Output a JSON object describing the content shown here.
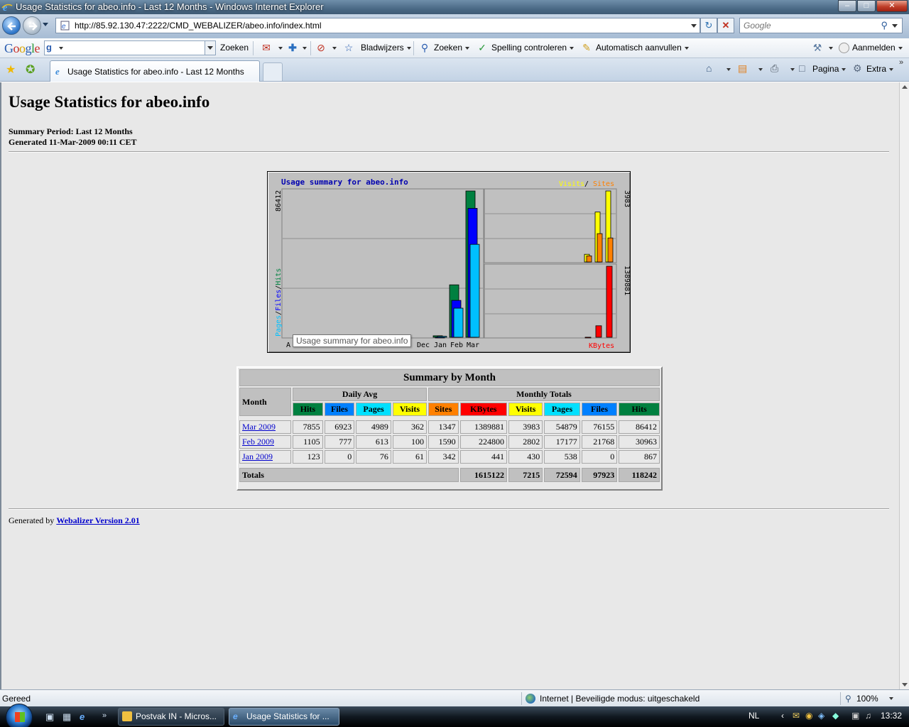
{
  "window": {
    "title": "Usage Statistics for abeo.info - Last 12 Months - Windows Internet Explorer"
  },
  "address_bar": {
    "url": "http://85.92.130.47:2222/CMD_WEBALIZER/abeo.info/index.html",
    "search_placeholder": "Google"
  },
  "google_toolbar": {
    "search_label": "Zoeken",
    "bookmarks_label": "Bladwijzers",
    "search2_label": "Zoeken",
    "spellcheck_label": "Spelling controleren",
    "autofill_label": "Automatisch aanvullen",
    "signin_label": "Aanmelden"
  },
  "tabs": {
    "active_tab_label": "Usage Statistics for abeo.info - Last 12 Months"
  },
  "command_bar": {
    "page_label": "Pagina",
    "extra_label": "Extra"
  },
  "page": {
    "title": "Usage Statistics for abeo.info",
    "summary_period": "Summary Period: Last 12 Months",
    "generated": "Generated 11-Mar-2009 00:11 CET"
  },
  "graph": {
    "title": "Usage summary for abeo.info",
    "legend_left": [
      "Pages",
      "Files",
      "Hits"
    ],
    "legend_visits": "Visits",
    "legend_sites": "Sites",
    "legend_kbytes": "KBytes",
    "max_hits_label": "86412",
    "max_visits_label": "3983",
    "max_kbytes_label": "1389881",
    "month_labels": [
      "Dec",
      "Jan",
      "Feb",
      "Mar"
    ],
    "partial_left_label": "A",
    "colors": {
      "hits": "#008040",
      "files": "#0000ff",
      "pages": "#00c0ff",
      "visits": "#ffff00",
      "sites": "#ff8000",
      "kbytes": "#ff0000"
    },
    "tooltip": "Usage summary for abeo.info"
  },
  "chart_data": {
    "type": "bar",
    "title": "Usage summary for abeo.info",
    "categories": [
      "Jan 2009",
      "Feb 2009",
      "Mar 2009"
    ],
    "series": [
      {
        "name": "Hits",
        "values": [
          867,
          30963,
          86412
        ]
      },
      {
        "name": "Files",
        "values": [
          0,
          21768,
          76155
        ]
      },
      {
        "name": "Pages",
        "values": [
          538,
          17177,
          54879
        ]
      },
      {
        "name": "Visits",
        "values": [
          430,
          2802,
          3983
        ]
      },
      {
        "name": "Sites",
        "values": [
          342,
          1590,
          1347
        ]
      },
      {
        "name": "KBytes",
        "values": [
          441,
          224800,
          1389881
        ]
      }
    ]
  },
  "table": {
    "caption": "Summary by Month",
    "month_header": "Month",
    "daily_avg_header": "Daily Avg",
    "monthly_totals_header": "Monthly Totals",
    "daily_cols": [
      "Hits",
      "Files",
      "Pages",
      "Visits"
    ],
    "monthly_cols": [
      "Sites",
      "KBytes",
      "Visits",
      "Pages",
      "Files",
      "Hits"
    ],
    "col_colors": {
      "Hits": "#008040",
      "Files": "#0080ff",
      "Pages": "#00e0ff",
      "Visits": "#ffff00",
      "Sites": "#ff8000",
      "KBytes": "#ff0000"
    },
    "rows": [
      {
        "month": "Mar 2009",
        "cells": [
          "7855",
          "6923",
          "4989",
          "362",
          "1347",
          "1389881",
          "3983",
          "54879",
          "76155",
          "86412"
        ]
      },
      {
        "month": "Feb 2009",
        "cells": [
          "1105",
          "777",
          "613",
          "100",
          "1590",
          "224800",
          "2802",
          "17177",
          "21768",
          "30963"
        ]
      },
      {
        "month": "Jan 2009",
        "cells": [
          "123",
          "0",
          "76",
          "61",
          "342",
          "441",
          "430",
          "538",
          "0",
          "867"
        ]
      }
    ],
    "totals_label": "Totals",
    "totals": [
      "1615122",
      "7215",
      "72594",
      "97923",
      "118242"
    ]
  },
  "footer": {
    "prefix": "Generated by ",
    "link": "Webalizer Version 2.01"
  },
  "status_bar": {
    "status": "Gereed",
    "zone": "Internet | Beveiligde modus: uitgeschakeld",
    "zoom": "100%"
  },
  "taskbar": {
    "buttons": [
      "Postvak IN - Micros...",
      "Usage Statistics for ..."
    ],
    "language": "NL",
    "clock": "13:32"
  }
}
